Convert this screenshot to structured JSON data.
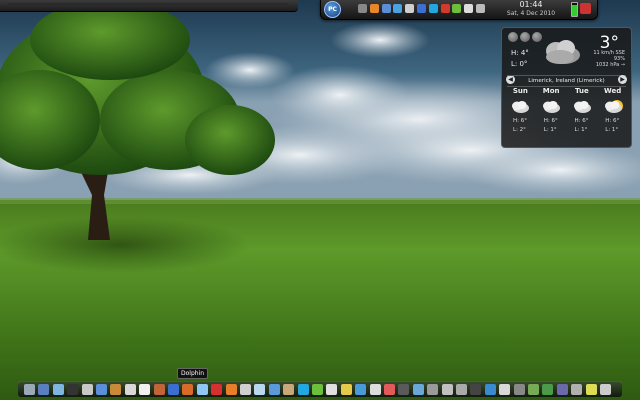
{
  "panel": {
    "clock_time": "01:44",
    "clock_date": "Sat, 4 Dec 2010",
    "logo_label": "PC",
    "tray_icons": [
      {
        "name": "window-list-icon",
        "color": "#888888"
      },
      {
        "name": "firefox-icon",
        "color": "#e8862a"
      },
      {
        "name": "folder-icon",
        "color": "#5a8fd8"
      },
      {
        "name": "chat-icon",
        "color": "#4aa3df"
      },
      {
        "name": "network-icon",
        "color": "#cfcfcf"
      },
      {
        "name": "bluetooth-icon",
        "color": "#3b6fd1"
      },
      {
        "name": "skype-icon",
        "color": "#23a7e0"
      },
      {
        "name": "update-icon",
        "color": "#d23b2b"
      },
      {
        "name": "signal-icon",
        "color": "#6cbf3b"
      },
      {
        "name": "volume-icon",
        "color": "#dddddd"
      },
      {
        "name": "device-notifier-icon",
        "color": "#bbbbbb"
      }
    ],
    "battery_level": 0.85
  },
  "weather": {
    "current_temp": "3°",
    "high": "H: 4°",
    "low": "L: 0°",
    "wind": "11 km/h SSE",
    "humidity": "93%",
    "pressure": "1032 hPa →",
    "location": "Limerick, Ireland (Limerick)",
    "forecast": [
      {
        "day": "Sun",
        "high": "H: 6°",
        "low": "L: 2°",
        "icon": "cloudy-icon"
      },
      {
        "day": "Mon",
        "high": "H: 6°",
        "low": "L: 1°",
        "icon": "cloudy-icon"
      },
      {
        "day": "Tue",
        "high": "H: 6°",
        "low": "L: 1°",
        "icon": "cloudy-icon"
      },
      {
        "day": "Wed",
        "high": "H: 6°",
        "low": "L: 1°",
        "icon": "partly-sunny-icon"
      }
    ]
  },
  "dock": {
    "tooltip": "Dolphin",
    "icons": [
      {
        "name": "desktop-icon",
        "color": "#9aa9b8"
      },
      {
        "name": "file-manager-icon",
        "color": "#5a7fc0"
      },
      {
        "name": "network-manager-icon",
        "color": "#7fb6e0"
      },
      {
        "name": "terminal-icon",
        "color": "#333333"
      },
      {
        "name": "system-settings-icon",
        "color": "#c8c8c8"
      },
      {
        "name": "software-center-icon",
        "color": "#5b8fd9"
      },
      {
        "name": "archive-icon",
        "color": "#c98a3a"
      },
      {
        "name": "calculator-icon",
        "color": "#d8d8d8"
      },
      {
        "name": "text-editor-icon",
        "color": "#f0f0f0"
      },
      {
        "name": "photo-editor-icon",
        "color": "#c2643a"
      },
      {
        "name": "info-icon",
        "color": "#3a6fd0"
      },
      {
        "name": "office-icon",
        "color": "#d86a2a"
      },
      {
        "name": "dolphin-icon",
        "color": "#8fc6f2"
      },
      {
        "name": "opera-icon",
        "color": "#d63030"
      },
      {
        "name": "firefox-icon",
        "color": "#e87d2a"
      },
      {
        "name": "media-player-icon",
        "color": "#cfcfcf"
      },
      {
        "name": "chat-icon",
        "color": "#b8d8f0"
      },
      {
        "name": "email-icon",
        "color": "#5a9ad8"
      },
      {
        "name": "photo-viewer-icon",
        "color": "#c8a878"
      },
      {
        "name": "skype-icon",
        "color": "#23a7e0"
      },
      {
        "name": "downloads-icon",
        "color": "#6cbf3b"
      },
      {
        "name": "calendar-icon",
        "color": "#e0e0e0"
      },
      {
        "name": "notes-icon",
        "color": "#e6c84a"
      },
      {
        "name": "globe-icon",
        "color": "#4a9ad8"
      },
      {
        "name": "clock-icon",
        "color": "#dddddd"
      },
      {
        "name": "music-icon",
        "color": "#e35a5a"
      },
      {
        "name": "video-icon",
        "color": "#5a5a5a"
      },
      {
        "name": "image-icon",
        "color": "#6aa8d8"
      },
      {
        "name": "settings-icon",
        "color": "#9a9a9a"
      },
      {
        "name": "disk-icon",
        "color": "#c0c0c0"
      },
      {
        "name": "printer-icon",
        "color": "#aaaaaa"
      },
      {
        "name": "camera-icon",
        "color": "#444444"
      },
      {
        "name": "help-icon",
        "color": "#3a8ad0"
      },
      {
        "name": "mail-icon",
        "color": "#d8d8d8"
      },
      {
        "name": "tools-icon",
        "color": "#888888"
      },
      {
        "name": "scanner-icon",
        "color": "#77aa55"
      },
      {
        "name": "games-icon",
        "color": "#4a9a4a"
      },
      {
        "name": "media-icon",
        "color": "#6a6aaa"
      },
      {
        "name": "trash-icon",
        "color": "#b0b0b0"
      },
      {
        "name": "weather-icon",
        "color": "#dddd55"
      },
      {
        "name": "power-icon",
        "color": "#cccccc"
      }
    ]
  }
}
